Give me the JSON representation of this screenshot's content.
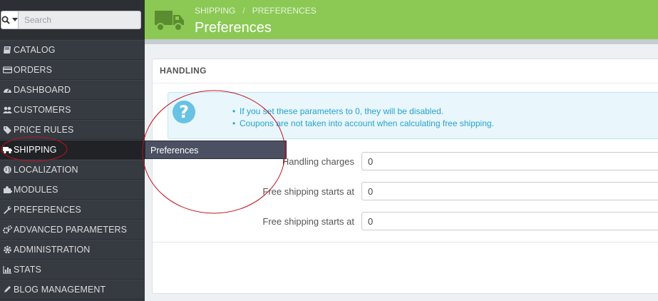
{
  "search": {
    "placeholder": "Search"
  },
  "sidebar": {
    "items": [
      {
        "label": "CATALOG",
        "icon": "book-icon"
      },
      {
        "label": "ORDERS",
        "icon": "credit-card-icon"
      },
      {
        "label": "DASHBOARD",
        "icon": "dashboard-icon"
      },
      {
        "label": "CUSTOMERS",
        "icon": "users-icon"
      },
      {
        "label": "PRICE RULES",
        "icon": "tags-icon"
      },
      {
        "label": "SHIPPING",
        "icon": "truck-icon",
        "active": true
      },
      {
        "label": "LOCALIZATION",
        "icon": "globe-icon"
      },
      {
        "label": "MODULES",
        "icon": "puzzle-icon"
      },
      {
        "label": "PREFERENCES",
        "icon": "wrench-icon"
      },
      {
        "label": "ADVANCED PARAMETERS",
        "icon": "cogs-icon"
      },
      {
        "label": "ADMINISTRATION",
        "icon": "cog-icon"
      },
      {
        "label": "STATS",
        "icon": "bar-chart-icon"
      },
      {
        "label": "BLOG MANAGEMENT",
        "icon": "pencil-icon"
      }
    ]
  },
  "header": {
    "breadcrumb": [
      "SHIPPING",
      "/",
      "PREFERENCES"
    ],
    "title": "Preferences"
  },
  "tooltip": {
    "label": "Preferences"
  },
  "panel": {
    "heading": "HANDLING",
    "alert": [
      "If you set these parameters to 0, they will be disabled.",
      "Coupons are not taken into account when calculating free shipping."
    ],
    "fields": [
      {
        "label": "Handling charges",
        "value": "0"
      },
      {
        "label": "Free shipping starts at",
        "value": "0"
      },
      {
        "label": "Free shipping starts at",
        "value": "0"
      }
    ]
  },
  "colors": {
    "header": "#8bc954",
    "sidebar": "#363a41",
    "alert_text": "#26a3cf",
    "annotation": "#c0101f"
  }
}
